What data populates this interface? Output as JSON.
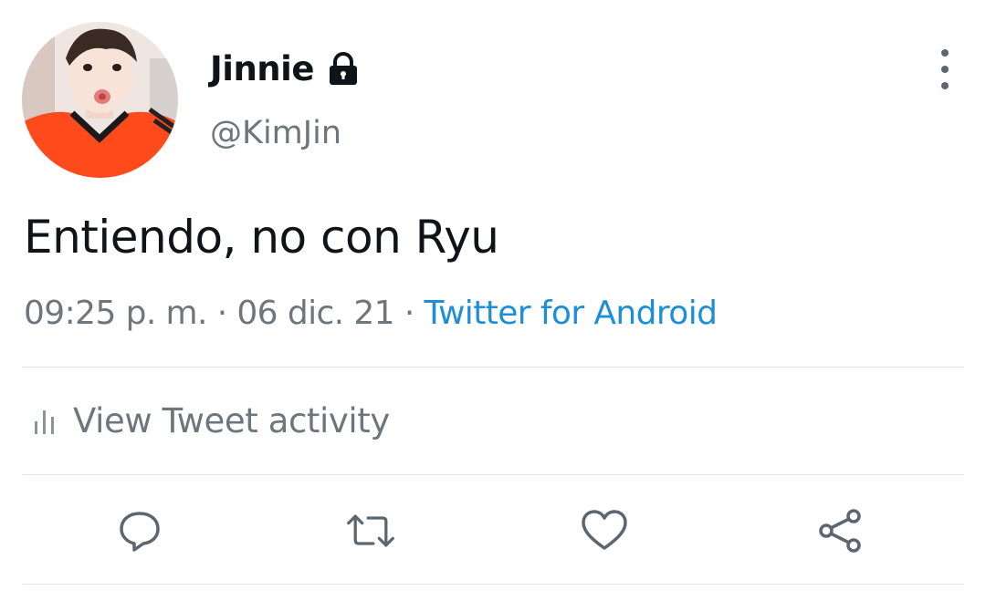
{
  "author": {
    "display_name": "Jinnie",
    "handle": "@KimJin",
    "protected": true
  },
  "tweet": {
    "text": "Entiendo, no con Ryu",
    "time": "09:25 p. m.",
    "separator": "·",
    "date": "06 dic. 21",
    "source": "Twitter for Android"
  },
  "activity": {
    "label": "View Tweet activity"
  },
  "actions": {
    "reply_icon": "reply-icon",
    "retweet_icon": "retweet-icon",
    "like_icon": "heart-icon",
    "share_icon": "share-icon"
  },
  "colors": {
    "text": "#0f1419",
    "secondary": "#6e767d",
    "link": "#1d8fd9",
    "divider": "#e1e5e8",
    "jersey": "#ff4a1c"
  }
}
